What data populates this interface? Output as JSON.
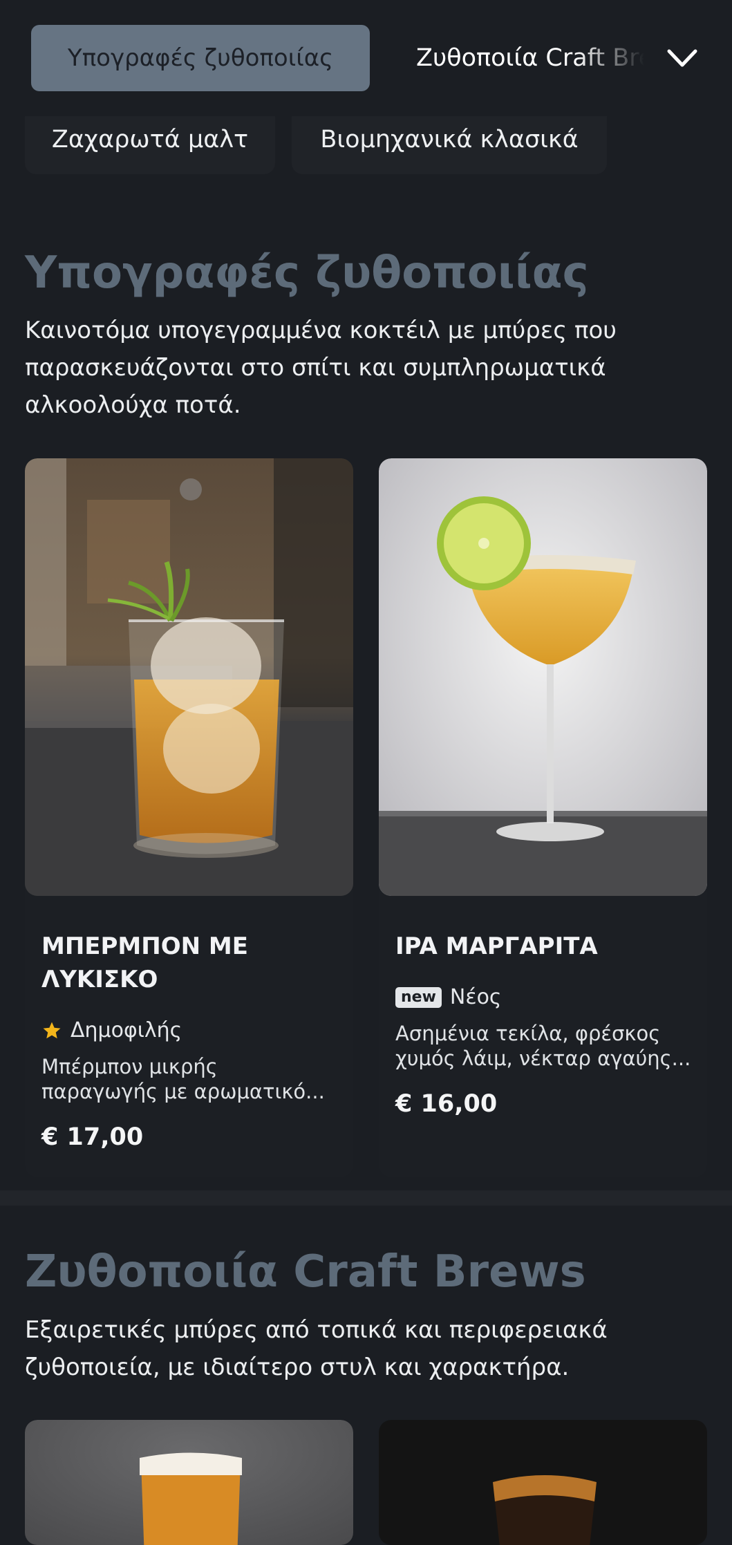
{
  "nav": {
    "active_tab": "Υπογραφές ζυθοποιίας",
    "next_tab": "Ζυθοποιία Craft Brews",
    "chevron": "chevron-down-icon"
  },
  "chips": [
    "Ζαχαρωτά μαλτ",
    "Βιομηχανικά κλασικά"
  ],
  "sections": [
    {
      "title": "Υπογραφές ζυθοποιίας",
      "description": "Καινοτόμα υπογεγραμμένα κοκτέιλ με μπύρες που παρασκευάζονται στο σπίτι και συμπληρωματικά αλκοολούχα ποτά.",
      "items": [
        {
          "name": "ΜΠΕΡΜΠΟΝ ΜΕ ΛΥΚΙΣΚΟ",
          "badge_icon": "star-icon",
          "badge_label": "Δημοφιλής",
          "desc_line1": "Μπέρμπον μικρής",
          "desc_line2": "παραγωγής με αρωματικό...",
          "price": "€ 17,00",
          "image": "whiskey-glass-image"
        },
        {
          "name": "IPA ΜΑΡΓΑΡΙΤΑ",
          "badge_tag": "new",
          "badge_label": "Νέος",
          "desc_line1": "Ασημένια τεκίλα, φρέσκος",
          "desc_line2": "χυμός λάιμ, νέκταρ αγαύης...",
          "price": "€ 16,00",
          "image": "margarita-glass-image"
        }
      ]
    },
    {
      "title": "Ζυθοποιία Craft Brews",
      "description": "Εξαιρετικές μπύρες από τοπικά και περιφερειακά ζυθοποιεία, με ιδιαίτερο στυλ και χαρακτήρα.",
      "items": [
        {
          "image": "lager-glass-image"
        },
        {
          "image": "stout-glass-image"
        }
      ]
    }
  ],
  "colors": {
    "background": "#1b1e23",
    "active_pill": "#667483",
    "section_title": "#5d6b79",
    "star": "#f3b51b"
  }
}
